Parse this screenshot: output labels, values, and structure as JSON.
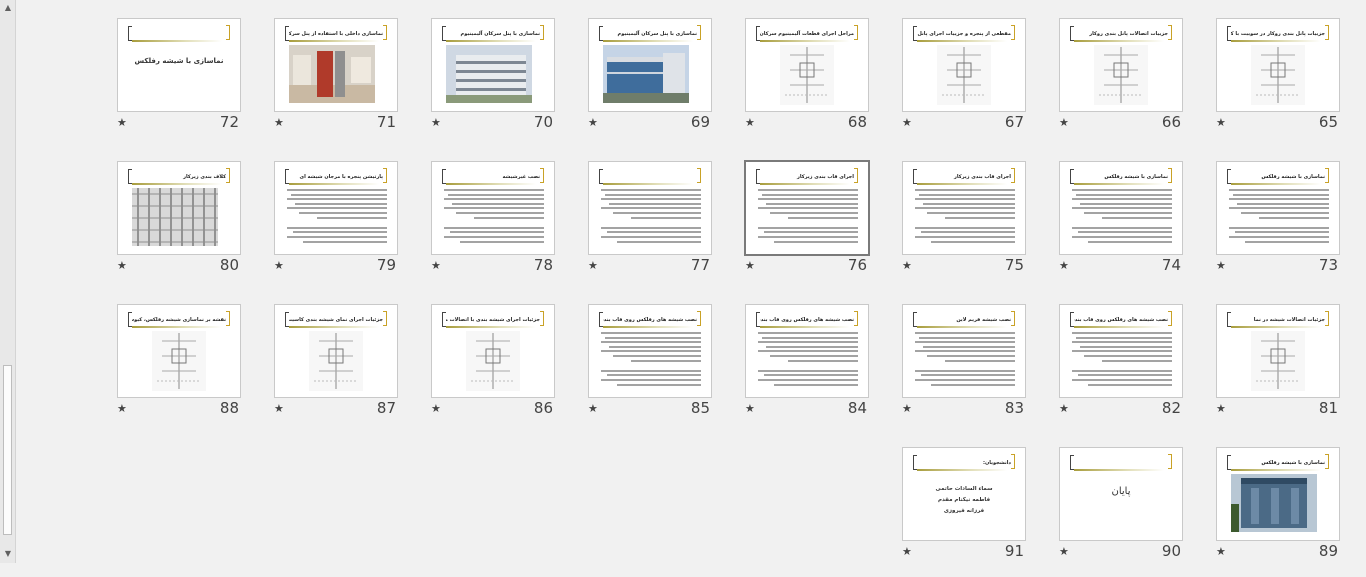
{
  "slides": [
    {
      "number": "72",
      "kind": "title",
      "title": "",
      "text": "نماسازی با شیشه رفلکس"
    },
    {
      "number": "71",
      "kind": "photo",
      "title": "نماسازی داخلی با استفاده از پنل سرکان آلیمینیوم",
      "photo": "interior"
    },
    {
      "number": "70",
      "kind": "photo",
      "title": "نماسازی با پنل سرکان آلیمینیوم",
      "photo": "building"
    },
    {
      "number": "69",
      "kind": "photo",
      "title": "نماسازی با پنل سرکان آلیمینیوم",
      "photo": "blue-building"
    },
    {
      "number": "68",
      "kind": "drawing",
      "title": "مراحل اجرای قطعات آلیمینیوم سرکان در نما"
    },
    {
      "number": "67",
      "kind": "drawing",
      "title": "مقطعی از پنجره و جزییات اجرای پانل بندی روکار"
    },
    {
      "number": "66",
      "kind": "drawing",
      "title": "جزییات اتصالات پانل بندی روکار"
    },
    {
      "number": "65",
      "kind": "drawing",
      "title": "جزییات پانل بندی روکار در سوییت با کلاف بندی زیرکار"
    },
    {
      "number": "80",
      "kind": "grid-photo",
      "title": "کلاف بندی زیرکار"
    },
    {
      "number": "79",
      "kind": "text",
      "title": "پارتیشن پنجره با مرجان شیشه ای"
    },
    {
      "number": "78",
      "kind": "text",
      "title": "نصب غیرشیشه"
    },
    {
      "number": "77",
      "kind": "text",
      "title": ""
    },
    {
      "number": "76",
      "kind": "text",
      "title": "اجرای قاب بندی زیرکار",
      "selected": true
    },
    {
      "number": "75",
      "kind": "text",
      "title": "اجرای قاب بندی زیرکار"
    },
    {
      "number": "74",
      "kind": "text",
      "title": "نماسازی با شیشه رفلکس"
    },
    {
      "number": "73",
      "kind": "text",
      "title": "نماسازی با شیشه رفلکس"
    },
    {
      "number": "88",
      "kind": "drawing",
      "title": "نقشه بر نماسازی شیشه رفلکس، کیوسک شیشه ای"
    },
    {
      "number": "87",
      "kind": "drawing",
      "title": "جزئیات اجرای نمای شیشه بندی کاسیت"
    },
    {
      "number": "86",
      "kind": "drawing",
      "title": "جزئیات اجرای شیشه بندی با اتصالات مکانیکی"
    },
    {
      "number": "85",
      "kind": "text",
      "title": "نصب شیشه های رفلکس روی قاب بندی"
    },
    {
      "number": "84",
      "kind": "text",
      "title": "نصب شیشه های رفلکس روی قاب بندی و شیوه نصب"
    },
    {
      "number": "83",
      "kind": "text",
      "title": "نصب شیشه فریم لاین"
    },
    {
      "number": "82",
      "kind": "text",
      "title": "نصب شیشه های رفلکس روی قاب بندی"
    },
    {
      "number": "81",
      "kind": "drawing",
      "title": "جزئیات اتصالات شیشه در نما"
    },
    {
      "number": "91",
      "kind": "members",
      "title": "دانشجویان:",
      "lines": [
        "سماء السادات حاتمی",
        "فاطمه نیکنام مقدم",
        "فرزانه فیروزی"
      ]
    },
    {
      "number": "90",
      "kind": "logo",
      "title": "",
      "text": "پایان"
    },
    {
      "number": "89",
      "kind": "photo",
      "title": "نماسازی با شیشه رفلکس",
      "photo": "glass"
    }
  ],
  "slide_star": "★",
  "scroll": {
    "up": "▲",
    "down": "▼"
  }
}
